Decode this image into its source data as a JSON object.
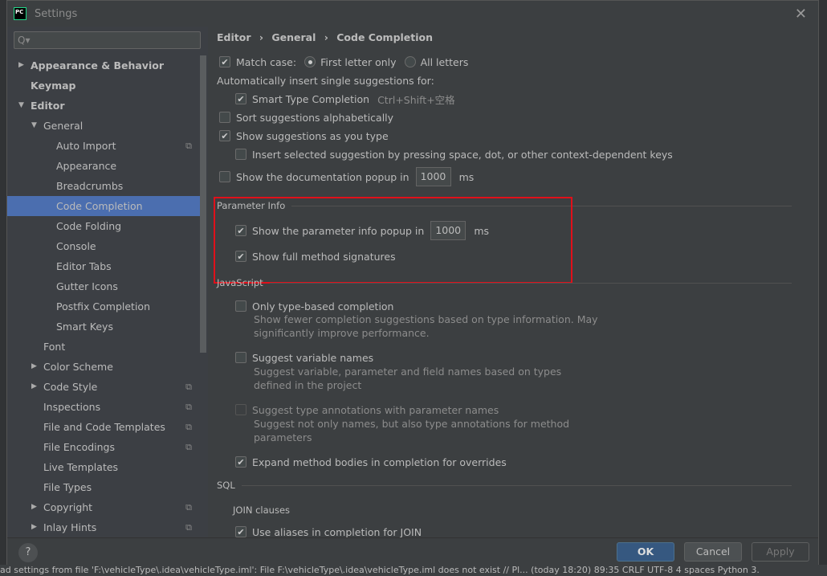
{
  "window": {
    "title": "Settings",
    "logo": "PC"
  },
  "search": {
    "placeholder": "Q▾"
  },
  "tree": [
    {
      "label": "Appearance & Behavior",
      "level": 0,
      "arrow": "▶",
      "bold": true
    },
    {
      "label": "Keymap",
      "level": 0,
      "arrow": "",
      "bold": true
    },
    {
      "label": "Editor",
      "level": 0,
      "arrow": "▼",
      "bold": true
    },
    {
      "label": "General",
      "level": 1,
      "arrow": "▼"
    },
    {
      "label": "Auto Import",
      "level": 2,
      "copy": true
    },
    {
      "label": "Appearance",
      "level": 2
    },
    {
      "label": "Breadcrumbs",
      "level": 2
    },
    {
      "label": "Code Completion",
      "level": 2,
      "selected": true
    },
    {
      "label": "Code Folding",
      "level": 2
    },
    {
      "label": "Console",
      "level": 2
    },
    {
      "label": "Editor Tabs",
      "level": 2
    },
    {
      "label": "Gutter Icons",
      "level": 2
    },
    {
      "label": "Postfix Completion",
      "level": 2
    },
    {
      "label": "Smart Keys",
      "level": 2
    },
    {
      "label": "Font",
      "level": 1
    },
    {
      "label": "Color Scheme",
      "level": 1,
      "arrow": "▶"
    },
    {
      "label": "Code Style",
      "level": 1,
      "arrow": "▶",
      "copy": true
    },
    {
      "label": "Inspections",
      "level": 1,
      "copy": true
    },
    {
      "label": "File and Code Templates",
      "level": 1,
      "copy": true
    },
    {
      "label": "File Encodings",
      "level": 1,
      "copy": true
    },
    {
      "label": "Live Templates",
      "level": 1
    },
    {
      "label": "File Types",
      "level": 1
    },
    {
      "label": "Copyright",
      "level": 1,
      "arrow": "▶",
      "copy": true
    },
    {
      "label": "Inlay Hints",
      "level": 1,
      "arrow": "▶",
      "copy": true
    }
  ],
  "breadcrumb": [
    "Editor",
    "General",
    "Code Completion"
  ],
  "breadcrumb_sep": "›",
  "settings": {
    "match_case": "Match case:",
    "first_letter": "First letter only",
    "all_letters": "All letters",
    "auto_insert": "Automatically insert single suggestions for:",
    "smart_type": "Smart Type Completion",
    "smart_type_shortcut": "Ctrl+Shift+空格",
    "sort_alpha": "Sort suggestions alphabetically",
    "show_as_type": "Show suggestions as you type",
    "insert_selected": "Insert selected suggestion by pressing space, dot, or other context-dependent keys",
    "doc_popup": "Show the documentation popup in",
    "doc_popup_ms": "1000",
    "ms": "ms",
    "param_info": "Parameter Info",
    "param_popup": "Show the parameter info popup in",
    "param_popup_ms": "1000",
    "full_sig": "Show full method signatures",
    "javascript": "JavaScript",
    "type_based": "Only type-based completion",
    "type_based_desc": "Show fewer completion suggestions based on type information. May significantly improve performance.",
    "var_names": "Suggest variable names",
    "var_names_desc": "Suggest variable, parameter and field names based on types defined in the project",
    "type_annot": "Suggest type annotations with parameter names",
    "type_annot_desc": "Suggest not only names, but also type annotations for method parameters",
    "expand_bodies": "Expand method bodies in completion for overrides",
    "sql": "SQL",
    "join_clauses": "JOIN clauses",
    "use_aliases": "Use aliases in completion for JOIN"
  },
  "footer": {
    "help": "?",
    "ok": "OK",
    "cancel": "Cancel",
    "apply": "Apply"
  },
  "statusbar": {
    "text": "ad settings from file 'F:\\vehicleType\\.idea\\vehicleType.iml': File F:\\vehicleType\\.idea\\vehicleType.iml does not exist // Pl... (today 18:20)   89:35   CRLF   UTF-8   4 spaces   Python 3."
  },
  "colors": {
    "accent": "#4b6eaf",
    "ok": "#365880",
    "highlight_box": "#e0101a"
  }
}
